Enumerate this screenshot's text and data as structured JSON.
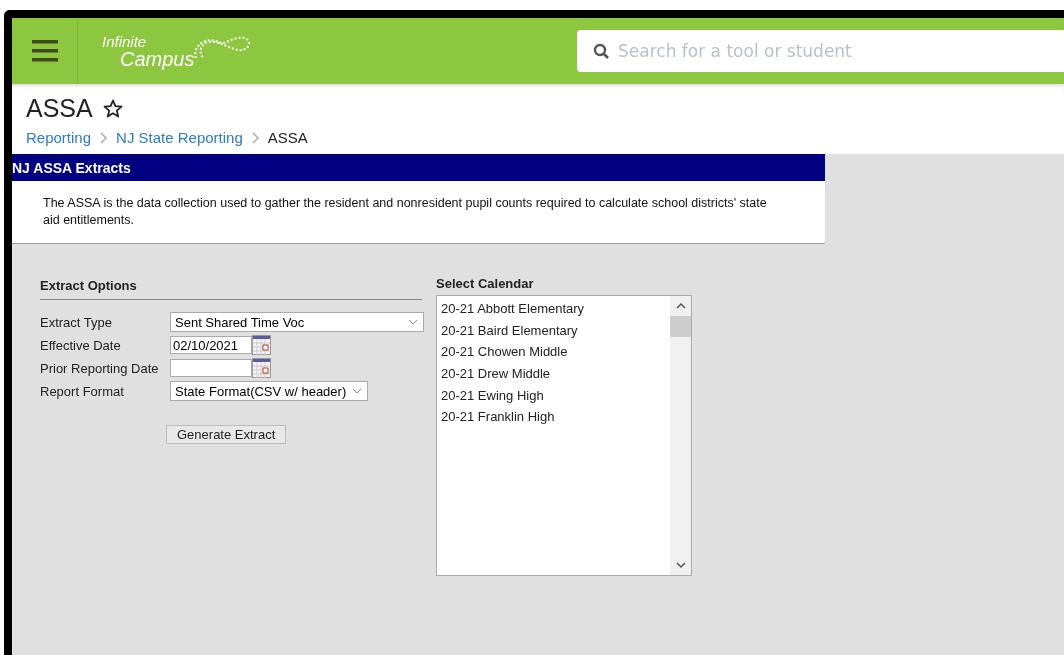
{
  "header": {
    "logo": {
      "line_1": "Infinite",
      "line_2": "Campus"
    },
    "search": {
      "placeholder": "Search for a tool or student"
    }
  },
  "page": {
    "title": "ASSA",
    "favorite": false,
    "breadcrumb": [
      {
        "label": "Reporting",
        "link": true
      },
      {
        "label": "NJ State Reporting",
        "link": true
      },
      {
        "label": "ASSA",
        "link": false
      }
    ]
  },
  "panel": {
    "title": "NJ ASSA Extracts",
    "description": "The ASSA is the data collection used to gather the resident and nonresident pupil counts required to calculate school districts' state aid entitlements."
  },
  "extract_options": {
    "title": "Extract Options",
    "fields": [
      {
        "label": "Extract Type",
        "kind": "select",
        "value": "Sent Shared Time Voc"
      },
      {
        "label": "Effective Date",
        "kind": "date",
        "value": "02/10/2021"
      },
      {
        "label": "Prior Reporting Date",
        "kind": "date"
      },
      {
        "label": "Report Format",
        "kind": "select",
        "value": "State Format(CSV w/ header)"
      }
    ],
    "button": "Generate Extract"
  },
  "select_calendar": {
    "title": "Select Calendar",
    "items": [
      {
        "label": "20-21 Abbott Elementary",
        "selected": false
      },
      {
        "label": "20-21 Baird Elementary",
        "selected": false
      },
      {
        "label": "20-21 Chowen Middle",
        "selected": false
      },
      {
        "label": "20-21 Drew Middle",
        "selected": false
      },
      {
        "label": "20-21 Ewing High",
        "selected": false
      },
      {
        "label": "20-21 Franklin High",
        "selected": false
      }
    ]
  }
}
